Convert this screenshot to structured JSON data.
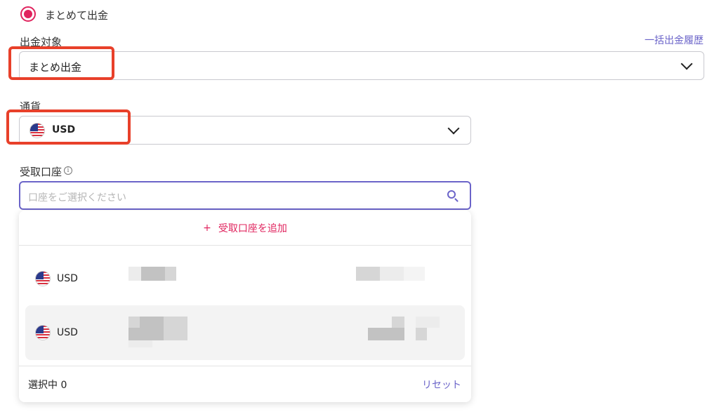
{
  "radio": {
    "label": "まとめて出金",
    "selected": true
  },
  "withdrawal_target": {
    "label": "出金対象",
    "value": "まとめ出金",
    "history_link": "一括出金履歴"
  },
  "currency": {
    "label": "通貨",
    "value": "USD",
    "icon": "us-flag-icon"
  },
  "receiving_account": {
    "label": "受取口座",
    "placeholder": "口座をご選択ください",
    "dropdown": {
      "add_label": "受取口座を追加",
      "add_icon": "+",
      "items": [
        {
          "currency": "USD"
        },
        {
          "currency": "USD"
        }
      ],
      "selected_count_label": "選択中 0",
      "reset_label": "リセット"
    }
  },
  "colors": {
    "accent": "#e0245e",
    "link": "#6b64c9",
    "highlight_border": "#e8402a"
  }
}
